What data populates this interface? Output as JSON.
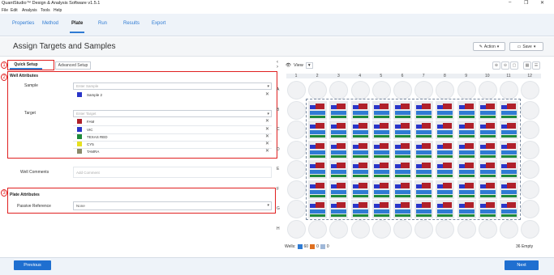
{
  "window": {
    "title": "QuantStudio™ Design & Analysis Software v1.5.1",
    "minimize": "–",
    "maximize": "❐",
    "close": "✕"
  },
  "menu": [
    "File",
    "Edit",
    "Analysis",
    "Tools",
    "Help"
  ],
  "nav": {
    "tabs": [
      "Properties",
      "Method",
      "Plate",
      "Run",
      "Results",
      "Export"
    ],
    "active": "Plate"
  },
  "header": {
    "title": "Assign Targets and Samples",
    "action_label": "Action",
    "save_label": "Save"
  },
  "setup_tabs": {
    "quick": "Quick Setup",
    "advanced": "Advanced Setup"
  },
  "markers": [
    "1",
    "2",
    "3"
  ],
  "well_attributes": {
    "heading": "Well Attributes",
    "sample_label": "Sample",
    "sample_placeholder": "Enter Sample",
    "samples": [
      {
        "name": "Sample 2",
        "color": "#2a35c8"
      }
    ],
    "target_label": "Target",
    "target_placeholder": "Enter Target",
    "targets": [
      {
        "name": "FAM",
        "color": "#b0202a"
      },
      {
        "name": "VIC",
        "color": "#2a35c8"
      },
      {
        "name": "TEXAS RED",
        "color": "#1e8a3a"
      },
      {
        "name": "CY5",
        "color": "#e6e020"
      },
      {
        "name": "TAMRA",
        "color": "#8a8a6a"
      }
    ],
    "well_comments_label": "Well Comments",
    "well_comments_placeholder": "Add Comment"
  },
  "plate_attributes": {
    "heading": "Plate Attributes",
    "passive_reference_label": "Passive Reference",
    "passive_reference_value": "None"
  },
  "plate": {
    "view_label": "View",
    "columns": [
      "1",
      "2",
      "3",
      "4",
      "5",
      "6",
      "7",
      "8",
      "9",
      "10",
      "11",
      "12"
    ],
    "rows": [
      "A",
      "B",
      "C",
      "D",
      "E",
      "F",
      "G",
      "H"
    ],
    "wells_label": "Wells:",
    "count_1": "60",
    "count_2": "0",
    "count_3": "0",
    "empty_label": "36 Empty"
  },
  "footer": {
    "previous": "Previous",
    "next": "Next"
  }
}
